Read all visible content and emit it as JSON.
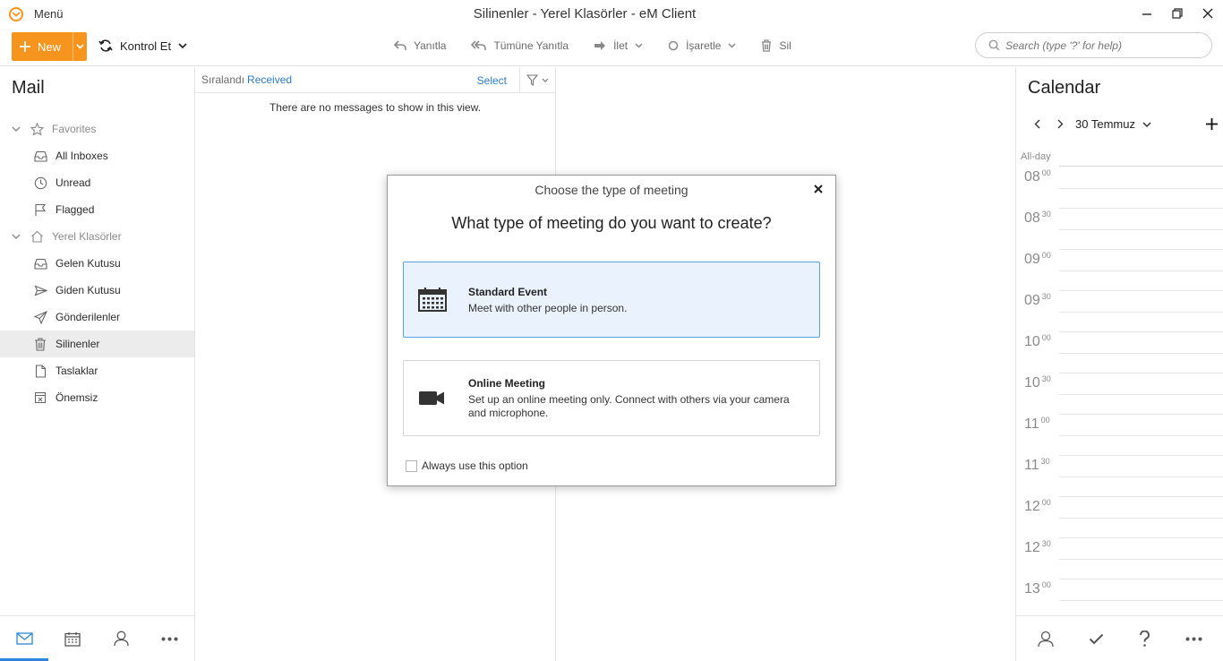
{
  "titlebar": {
    "menu_label": "Menü",
    "window_title": "Silinenler - Yerel Klasörler - eM Client"
  },
  "toolbar": {
    "new_label": "New",
    "check_label": "Kontrol Et",
    "actions": {
      "reply": "Yanıtla",
      "reply_all": "Tümüne Yanıtla",
      "forward": "İlet",
      "mark": "İşaretle",
      "delete": "Sil"
    },
    "search_placeholder": "Search (type '?' for help)"
  },
  "sidebar": {
    "title": "Mail",
    "favorites": {
      "label": "Favorites",
      "items": [
        "All Inboxes",
        "Unread",
        "Flagged"
      ]
    },
    "local": {
      "label": "Yerel Klasörler",
      "items": [
        "Gelen Kutusu",
        "Giden Kutusu",
        "Gönderilenler",
        "Silinenler",
        "Taslaklar",
        "Önemsiz"
      ],
      "active": "Silinenler"
    }
  },
  "msglist": {
    "sorted_label": "Sıralandı",
    "sorted_value": "Received",
    "select_label": "Select",
    "empty_text": "There are no messages to show in this view."
  },
  "calendar": {
    "title": "Calendar",
    "date_label": "30 Temmuz",
    "allday_label": "All-day",
    "hours": [
      {
        "h": "08",
        "m": "00"
      },
      {
        "h": "08",
        "m": "30"
      },
      {
        "h": "09",
        "m": "00"
      },
      {
        "h": "09",
        "m": "30"
      },
      {
        "h": "10",
        "m": "00"
      },
      {
        "h": "10",
        "m": "30"
      },
      {
        "h": "11",
        "m": "00"
      },
      {
        "h": "11",
        "m": "30"
      },
      {
        "h": "12",
        "m": "00"
      },
      {
        "h": "12",
        "m": "30"
      },
      {
        "h": "13",
        "m": "00"
      }
    ]
  },
  "dialog": {
    "title": "Choose the type of meeting",
    "heading": "What type of meeting do you want to create?",
    "options": [
      {
        "name": "Standard Event",
        "desc": "Meet with other people in person."
      },
      {
        "name": "Online Meeting",
        "desc": "Set up an online meeting only. Connect with others via your camera and microphone."
      }
    ],
    "always_label": "Always use this option"
  },
  "colors": {
    "accent_orange": "#f7941d",
    "link_blue": "#2a7bc8",
    "selected_option_bg": "#eaf3fd"
  }
}
